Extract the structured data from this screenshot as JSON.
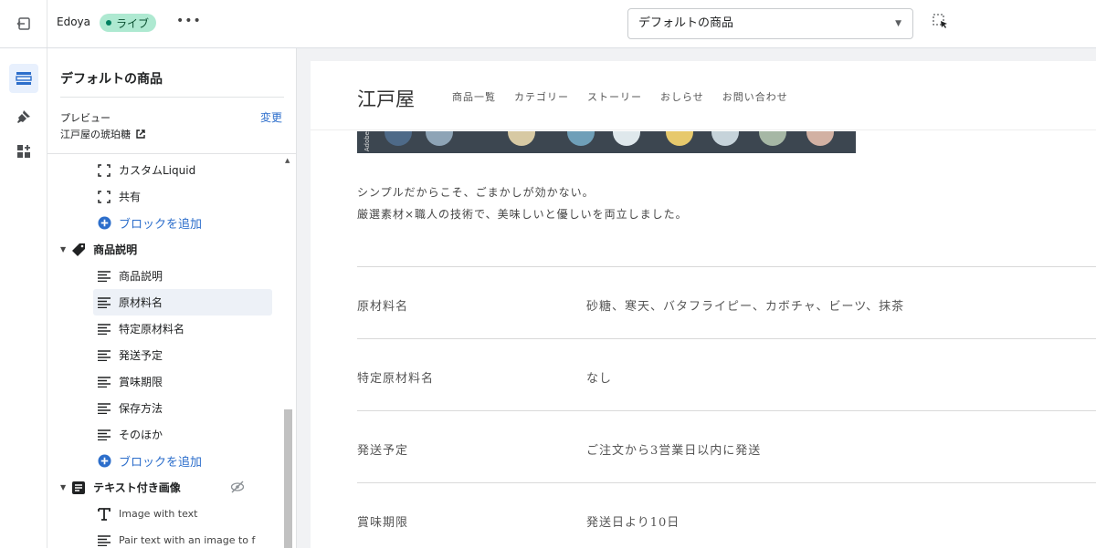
{
  "topbar": {
    "store_name": "Edoya",
    "status_badge": "ライブ",
    "more_label": "•••",
    "template_select": "デフォルトの商品"
  },
  "sidebar": {
    "title": "デフォルトの商品",
    "preview_label": "プレビュー",
    "preview_value": "江戸屋の琥珀糖",
    "change_link": "変更",
    "tree": [
      {
        "label": "カスタムLiquid",
        "icon": "bracket-icon"
      },
      {
        "label": "共有",
        "icon": "bracket-icon"
      },
      {
        "label": "ブロックを追加",
        "icon": "plus-circle-icon"
      },
      {
        "label": "商品説明",
        "icon": "tag-icon"
      },
      {
        "label": "商品説明",
        "icon": "text-lines-icon"
      },
      {
        "label": "原材料名",
        "icon": "text-lines-icon"
      },
      {
        "label": "特定原材料名",
        "icon": "text-lines-icon"
      },
      {
        "label": "発送予定",
        "icon": "text-lines-icon"
      },
      {
        "label": "賞味期限",
        "icon": "text-lines-icon"
      },
      {
        "label": "保存方法",
        "icon": "text-lines-icon"
      },
      {
        "label": "そのほか",
        "icon": "text-lines-icon"
      },
      {
        "label": "ブロックを追加",
        "icon": "plus-circle-icon"
      },
      {
        "label": "テキスト付き画像",
        "icon": "text-image-icon"
      },
      {
        "label": "Image with text",
        "icon": "text-t-icon"
      },
      {
        "label": "Pair text with an image to f",
        "icon": "text-lines-icon"
      }
    ]
  },
  "preview": {
    "logo": "江戸屋",
    "nav": [
      "商品一覧",
      "カテゴリー",
      "ストーリー",
      "おしらせ",
      "お問い合わせ"
    ],
    "hero_tag": "Adobe",
    "desc_line1": "シンプルだからこそ、ごまかしが効かない。",
    "desc_line2": "厳選素材×職人の技術で、美味しいと優しいを両立しました。",
    "table": [
      {
        "key": "原材料名",
        "value": "砂糖、寒天、バタフライピー、カボチャ、ビーツ、抹茶"
      },
      {
        "key": "特定原材料名",
        "value": "なし"
      },
      {
        "key": "発送予定",
        "value": "ご注文から3営業日以内に発送"
      },
      {
        "key": "賞味期限",
        "value": "発送日より10日"
      }
    ]
  },
  "colors": {
    "accent": "#2c6ecb",
    "live_badge": "#aee9d1",
    "selected_row": "#edf1f7"
  }
}
